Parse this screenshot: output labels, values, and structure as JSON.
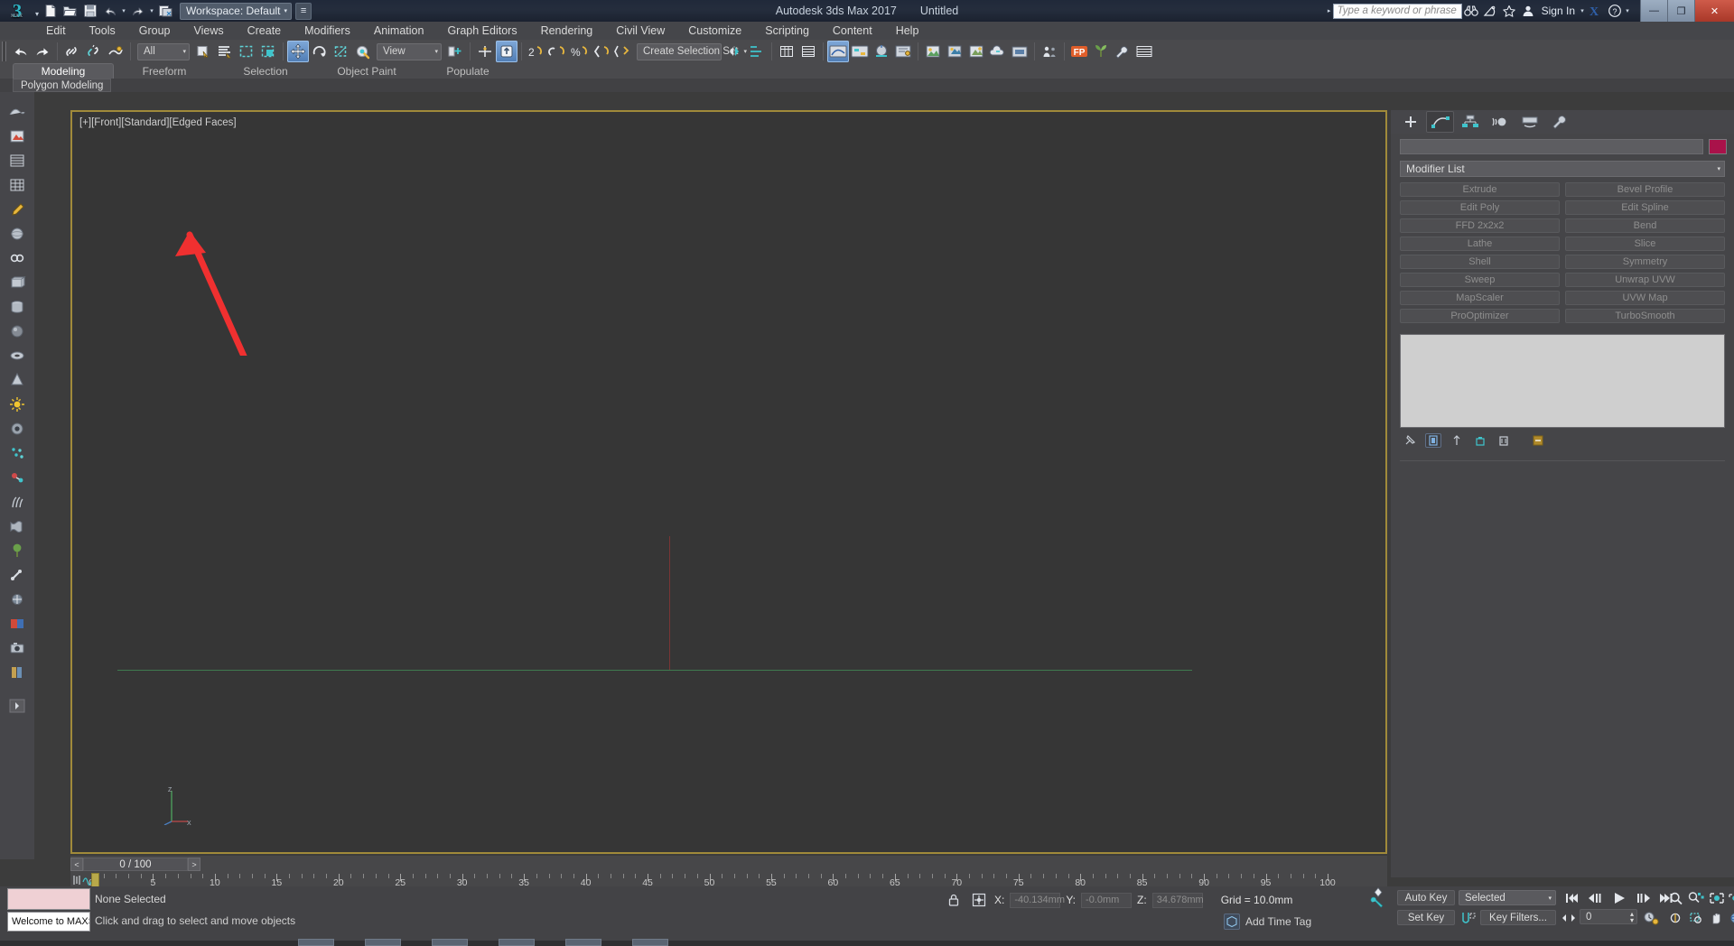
{
  "app": {
    "title": "Autodesk 3ds Max 2017",
    "document": "Untitled",
    "workspace_label": "Workspace: Default",
    "sign_in": "Sign In",
    "search_placeholder": "Type a keyword or phrase"
  },
  "window_controls": {
    "minimize": "—",
    "restore": "❐",
    "close": "✕"
  },
  "quick_access": [
    {
      "name": "new-scene-icon",
      "glyph": "📄"
    },
    {
      "name": "open-file-icon",
      "glyph": "📂"
    },
    {
      "name": "save-file-icon",
      "glyph": "💾"
    },
    {
      "name": "undo-icon",
      "glyph": "↩"
    },
    {
      "name": "undo-dropdown-icon",
      "glyph": "▾"
    },
    {
      "name": "redo-icon",
      "glyph": "↪"
    },
    {
      "name": "redo-dropdown-icon",
      "glyph": "▾"
    },
    {
      "name": "project-folder-icon",
      "glyph": "🗂"
    }
  ],
  "menu": [
    "Edit",
    "Tools",
    "Group",
    "Views",
    "Create",
    "Modifiers",
    "Animation",
    "Graph Editors",
    "Rendering",
    "Civil View",
    "Customize",
    "Scripting",
    "Content",
    "Help"
  ],
  "toolbar": {
    "selection_filter": "All",
    "reference_coord": "View",
    "selection_set": "Create Selection Set"
  },
  "ribbon": {
    "tabs": [
      {
        "label": "Modeling",
        "active": true
      },
      {
        "label": "Freeform",
        "active": false
      },
      {
        "label": "Selection",
        "active": false
      },
      {
        "label": "Object Paint",
        "active": false
      },
      {
        "label": "Populate",
        "active": false
      }
    ],
    "panel_label": "Polygon Modeling"
  },
  "viewport": {
    "label": "[+][Front][Standard][Edged Faces]",
    "axis_labels": {
      "y": "Z",
      "x": "X"
    }
  },
  "command_panel": {
    "tabs": [
      {
        "name": "create-tab",
        "active": false
      },
      {
        "name": "modify-tab",
        "active": true
      },
      {
        "name": "hierarchy-tab",
        "active": false
      },
      {
        "name": "motion-tab",
        "active": false
      },
      {
        "name": "display-tab",
        "active": false
      },
      {
        "name": "utilities-tab",
        "active": false
      }
    ],
    "object_name": "",
    "object_color": "#a9124a",
    "modifier_list_label": "Modifier List",
    "modifier_buttons": [
      "Extrude",
      "Bevel Profile",
      "Edit Poly",
      "Edit Spline",
      "FFD 2x2x2",
      "Bend",
      "Lathe",
      "Slice",
      "Shell",
      "Symmetry",
      "Sweep",
      "Unwrap UVW",
      "MapScaler",
      "UVW Map",
      "ProOptimizer",
      "TurboSmooth"
    ]
  },
  "timeline": {
    "frame_display": "0 / 100",
    "prev_arrow": "<",
    "next_arrow": ">",
    "tick_labels": [
      "0",
      "5",
      "10",
      "15",
      "20",
      "25",
      "30",
      "35",
      "40",
      "45",
      "50",
      "55",
      "60",
      "65",
      "70",
      "75",
      "80",
      "85",
      "90",
      "95",
      "100"
    ],
    "current_frame": 0,
    "range_start": 0,
    "range_end": 100
  },
  "status_bar": {
    "maxscript_label": "Welcome to MAXScript.",
    "selection_status": "None Selected",
    "prompt": "Click and drag to select and move objects",
    "coordinates": {
      "x_label": "X:",
      "x_value": "-40.134mm",
      "y_label": "Y:",
      "y_value": "-0.0mm",
      "z_label": "Z:",
      "z_value": "34.678mm"
    },
    "grid_text": "Grid = 10.0mm",
    "add_time_tag": "Add Time Tag"
  },
  "animation_controls": {
    "auto_key": "Auto Key",
    "set_key": "Set Key",
    "key_mode": "Selected",
    "key_filters": "Key Filters...",
    "current_frame_field": "0"
  },
  "colors": {
    "accent_viewport_border": "#a08a3a",
    "grid_green": "#3f7a4f",
    "grid_red": "#7a3535",
    "annotation_arrow": "#f03030",
    "title_bar": "#222a38",
    "panel_bg": "#454548",
    "toolbar_bg": "#4a4a4d"
  }
}
